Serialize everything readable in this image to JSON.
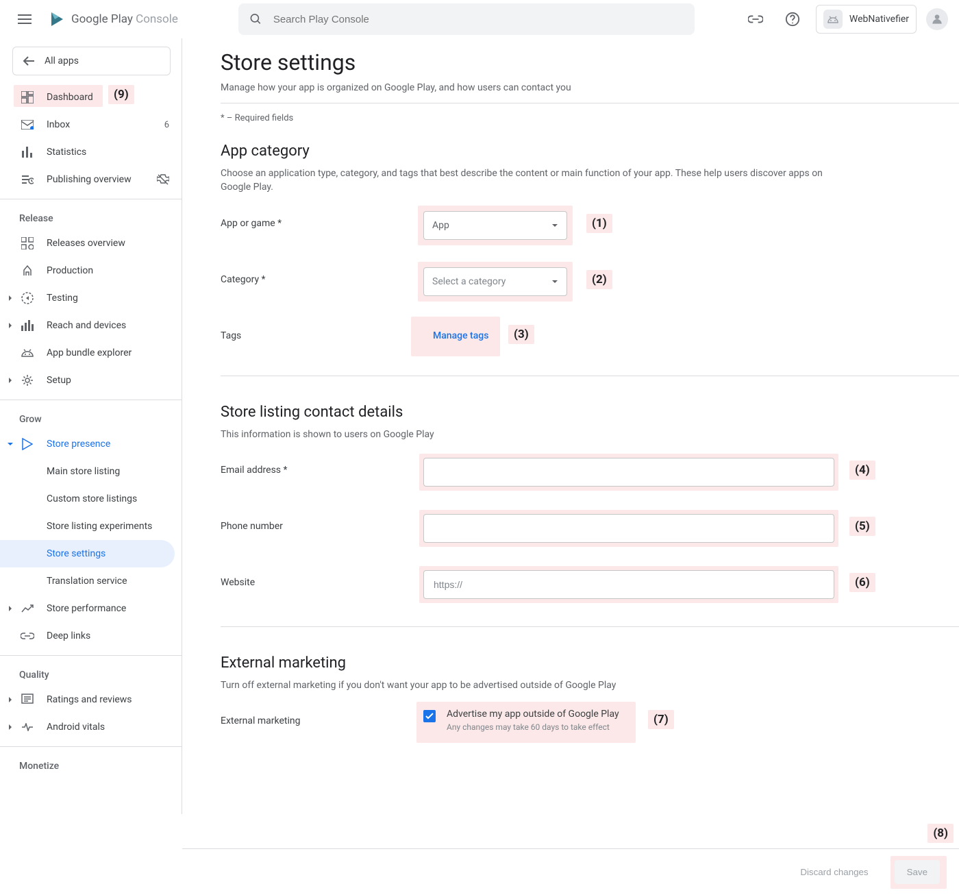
{
  "header": {
    "logo_primary": "Google Play",
    "logo_secondary": "Console",
    "search_placeholder": "Search Play Console",
    "account_name": "WebNativefier"
  },
  "sidebar": {
    "all_apps": "All apps",
    "top": {
      "dashboard": "Dashboard",
      "inbox": "Inbox",
      "inbox_count": "6",
      "statistics": "Statistics",
      "publishing": "Publishing overview"
    },
    "release": {
      "label": "Release",
      "overview": "Releases overview",
      "production": "Production",
      "testing": "Testing",
      "reach": "Reach and devices",
      "bundle": "App bundle explorer",
      "setup": "Setup"
    },
    "grow": {
      "label": "Grow",
      "store_presence": "Store presence",
      "main_listing": "Main store listing",
      "custom_listings": "Custom store listings",
      "experiments": "Store listing experiments",
      "store_settings": "Store settings",
      "translation": "Translation service",
      "performance": "Store performance",
      "deep_links": "Deep links"
    },
    "quality": {
      "label": "Quality",
      "ratings": "Ratings and reviews",
      "vitals": "Android vitals"
    },
    "monetize": {
      "label": "Monetize"
    }
  },
  "main": {
    "title": "Store settings",
    "subtitle": "Manage how your app is organized on Google Play, and how users can contact you",
    "required_note": "* – Required fields",
    "app_category": {
      "title": "App category",
      "desc": "Choose an application type, category, and tags that best describe the content or main function of your app. These help users discover apps on Google Play.",
      "app_or_game_label": "App or game  *",
      "app_or_game_value": "App",
      "category_label": "Category  *",
      "category_placeholder": "Select a category",
      "tags_label": "Tags",
      "manage_tags": "Manage tags"
    },
    "contact": {
      "title": "Store listing contact details",
      "desc": "This information is shown to users on Google Play",
      "email_label": "Email address  *",
      "phone_label": "Phone number",
      "website_label": "Website",
      "website_placeholder": "https://"
    },
    "external": {
      "title": "External marketing",
      "desc": "Turn off external marketing if you don't want your app to be advertised outside of Google Play",
      "row_label": "External marketing",
      "checkbox_label": "Advertise my app outside of Google Play",
      "checkbox_sub": "Any changes may take 60 days to take effect"
    }
  },
  "footer": {
    "discard": "Discard changes",
    "save": "Save"
  },
  "callouts": {
    "c1": "(1)",
    "c2": "(2)",
    "c3": "(3)",
    "c4": "(4)",
    "c5": "(5)",
    "c6": "(6)",
    "c7": "(7)",
    "c8": "(8)",
    "c9": "(9)"
  }
}
